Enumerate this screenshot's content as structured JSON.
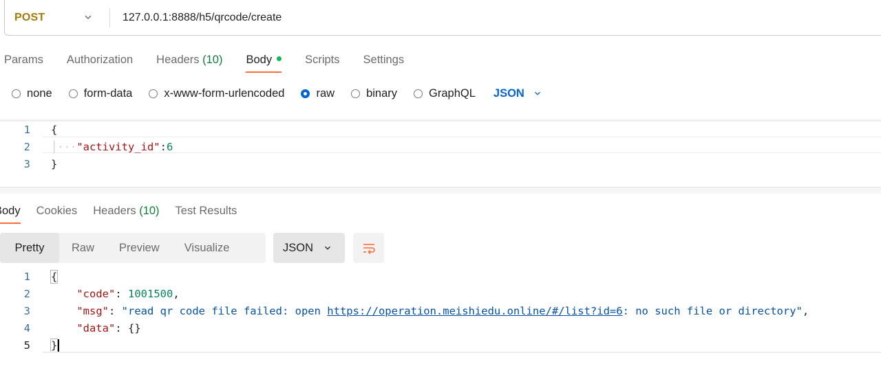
{
  "request": {
    "method": "POST",
    "url": "127.0.0.1:8888/h5/qrcode/create"
  },
  "request_tabs": [
    {
      "label": "Params"
    },
    {
      "label": "Authorization"
    },
    {
      "label": "Headers",
      "count": "(10)"
    },
    {
      "label": "Body"
    },
    {
      "label": "Scripts"
    },
    {
      "label": "Settings"
    }
  ],
  "body_modes": {
    "none": "none",
    "form_data": "form-data",
    "urlencoded": "x-www-form-urlencoded",
    "raw": "raw",
    "binary": "binary",
    "graphql": "GraphQL",
    "language": "JSON"
  },
  "request_body": {
    "line_numbers": [
      "1",
      "2",
      "3"
    ],
    "open": "{",
    "key": "\"activity_id\"",
    "colon": ":",
    "value": "6",
    "close": "}"
  },
  "response_tabs": [
    {
      "label": "Body"
    },
    {
      "label": "Cookies"
    },
    {
      "label": "Headers",
      "count": "(10)"
    },
    {
      "label": "Test Results"
    }
  ],
  "response_view": {
    "pretty": "Pretty",
    "raw": "Raw",
    "preview": "Preview",
    "visualize": "Visualize",
    "format": "JSON"
  },
  "response_body": {
    "line_numbers": [
      "1",
      "2",
      "3",
      "4",
      "5"
    ],
    "open": "{",
    "code_key": "\"code\"",
    "code_value": "1001500",
    "msg_key": "\"msg\"",
    "msg_prefix": "\"read qr code file failed: open ",
    "msg_link": "https://operation.meishiedu.online/#/list?id=6",
    "msg_suffix": ": no such file or directory\"",
    "data_key": "\"data\"",
    "data_value": "{}",
    "close": "}"
  },
  "colors": {
    "method": "#a27b0a",
    "accent": "#ff6c37",
    "link_blue": "#0265d2",
    "count_green": "#0f7b3c"
  },
  "icons": {
    "method_dropdown": "chevron-down-icon",
    "language_dropdown": "chevron-down-icon",
    "wrap": "wrap-lines-icon"
  }
}
